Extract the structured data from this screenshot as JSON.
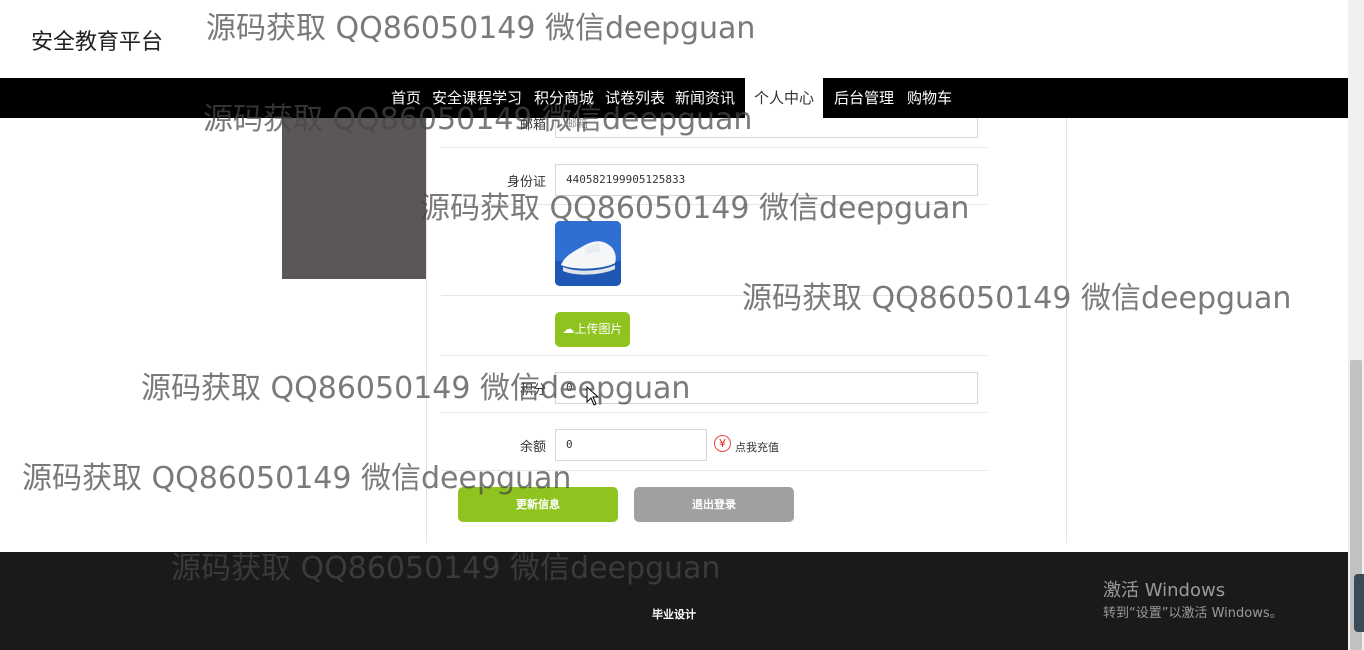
{
  "header": {
    "site_title": "安全教育平台"
  },
  "nav": {
    "items": [
      {
        "label": "首页"
      },
      {
        "label": "安全课程学习"
      },
      {
        "label": "积分商城"
      },
      {
        "label": "试卷列表"
      },
      {
        "label": "新闻资讯"
      },
      {
        "label": "个人中心",
        "active": true
      },
      {
        "label": "后台管理"
      },
      {
        "label": "购物车"
      }
    ]
  },
  "form": {
    "email": {
      "label": "邮箱",
      "value": "邮箱"
    },
    "id_card": {
      "label": "身份证",
      "value": "440582199905125833"
    },
    "photo": {
      "icon": "sneaker-photo"
    },
    "upload_label": "上传图片",
    "points": {
      "label": "积分",
      "value": "0"
    },
    "balance": {
      "label": "余额",
      "value": "0"
    },
    "recharge_icon": "¥",
    "recharge_label": "点我充值",
    "update_button": "更新信息",
    "logout_button": "退出登录"
  },
  "footer": {
    "text": "毕业设计"
  },
  "watermark": "源码获取 QQ86050149 微信deepguan",
  "os": {
    "activation_title": "激活 Windows",
    "activation_sub": "转到“设置”以激活 Windows。"
  },
  "colors": {
    "accent": "#8fc31f",
    "nav_bg": "#000000",
    "footer_bg": "#1a1a1a",
    "logout": "#a0a0a0"
  }
}
